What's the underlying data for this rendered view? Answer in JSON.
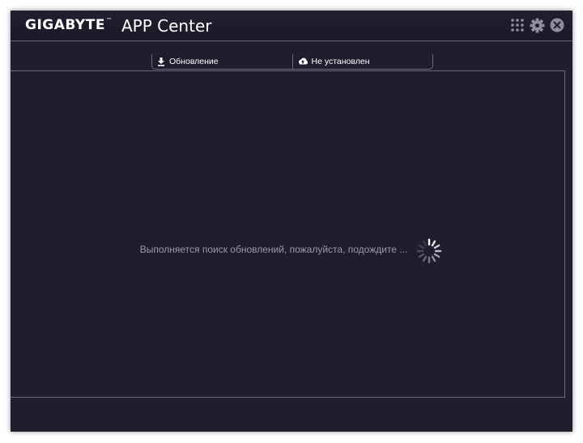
{
  "window": {
    "brand": "GIGABYTE",
    "trademark": "™",
    "app_title": "APP Center"
  },
  "titlebar": {
    "controls": [
      {
        "icon": "apps-grid-icon"
      },
      {
        "icon": "gear-icon"
      },
      {
        "icon": "close-icon"
      }
    ]
  },
  "tabs": [
    {
      "label": "Обновление",
      "icon": "download-icon"
    },
    {
      "label": "Не установлен",
      "icon": "cloud-icon"
    }
  ],
  "main": {
    "status_text": "Выполняется поиск обновлений, пожалуйста, подождите ..."
  },
  "colors": {
    "background": "#1f1e2e",
    "border": "#6b6a7a",
    "text": "#ffffff",
    "status_text": "#9a9aa6"
  }
}
